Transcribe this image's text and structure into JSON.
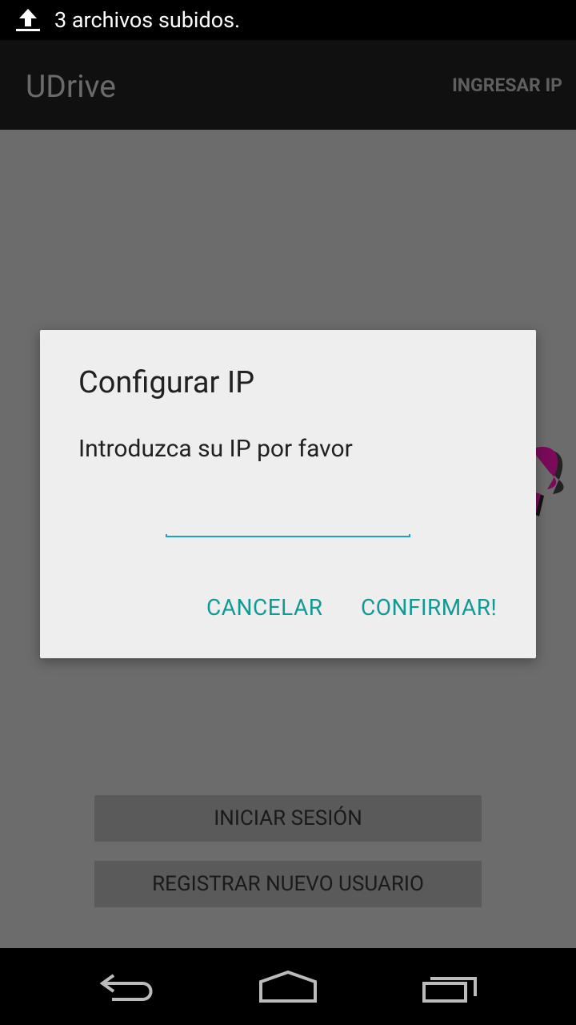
{
  "status_bar": {
    "icon": "upload-icon",
    "text": "3 archivos subidos."
  },
  "action_bar": {
    "title": "UDrive",
    "action_label": "INGRESAR IP"
  },
  "main": {
    "login_label": "INICIAR SESIÓN",
    "register_label": "REGISTRAR NUEVO USUARIO"
  },
  "dialog": {
    "title": "Configurar IP",
    "message": "Introduzca su IP por favor",
    "input_value": "",
    "cancel_label": "CANCELAR",
    "confirm_label": "CONFIRMAR!"
  },
  "nav_bar": {
    "back_icon": "back-icon",
    "home_icon": "home-icon",
    "recents_icon": "recent-apps-icon"
  },
  "colors": {
    "accent": "#119a94",
    "input_underline": "#1ea0c8",
    "dim_background": "#6c6c6c",
    "dialog_background": "#eeeeee"
  }
}
